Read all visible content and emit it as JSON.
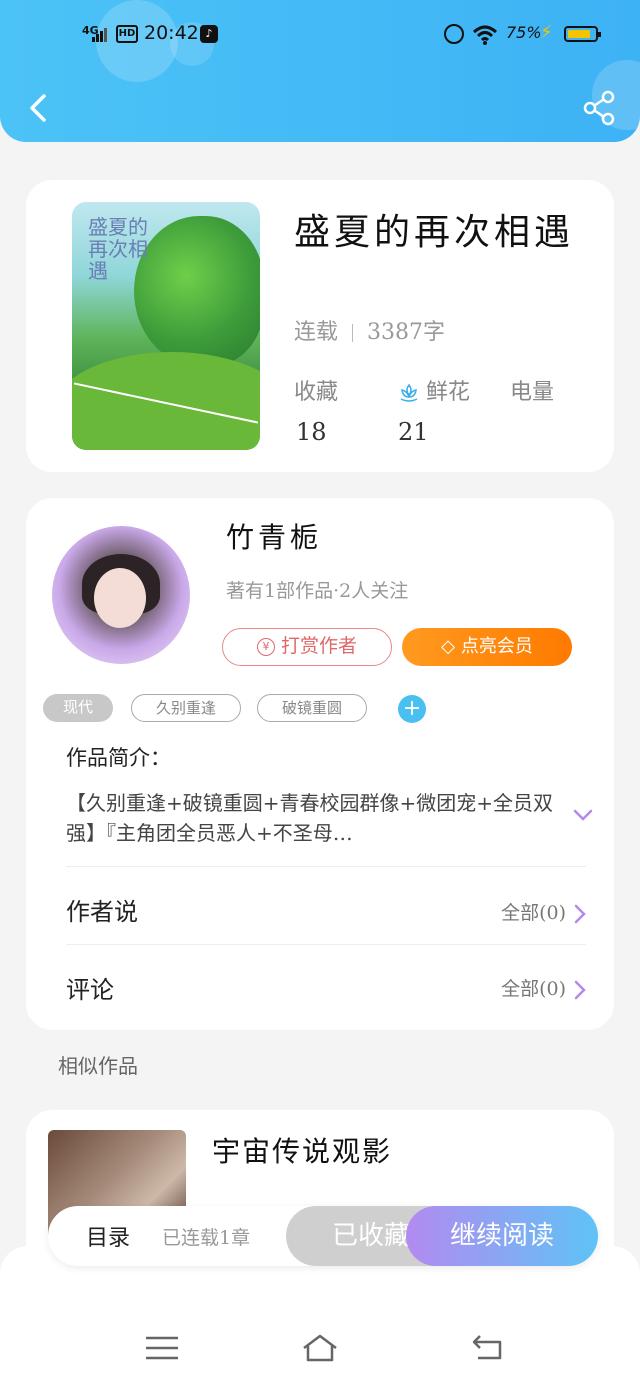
{
  "status_bar": {
    "network": "4G",
    "hd_badge": "HD",
    "time": "20:42",
    "battery_percent": "75%"
  },
  "header": {
    "back_icon": "back-arrow",
    "share_icon": "share"
  },
  "book": {
    "cover_title": "盛夏的再次相遇",
    "title": "盛夏的再次相遇",
    "status": "连载",
    "word_count": "3387字",
    "stats": {
      "favorites_label": "收藏",
      "favorites_value": "18",
      "flowers_label": "鲜花",
      "flowers_value": "21",
      "power_label": "电量"
    }
  },
  "author": {
    "name": "竹青栀",
    "meta": "著有1部作品·2人关注",
    "tip_button": "打赏作者",
    "vip_button": "点亮会员",
    "tags": [
      "现代",
      "久别重逢",
      "破镜重圆"
    ]
  },
  "intro": {
    "label": "作品简介：",
    "text": "【久别重逢+破镜重圆+青春校园群像+微团宠+全员双强】『主角团全员恶人+不圣母…"
  },
  "rows": {
    "author_says": {
      "label": "作者说",
      "value": "全部(0)"
    },
    "comments": {
      "label": "评论",
      "value": "全部(0)"
    }
  },
  "similar": {
    "section_title": "相似作品",
    "items": [
      {
        "title": "宇宙传说观影"
      }
    ]
  },
  "bottom_bar": {
    "toc": "目录",
    "status": "已连载1章",
    "collected": "已收藏",
    "continue": "继续阅读"
  },
  "colors": {
    "header_blue": "#4cc3f6",
    "accent_orange": "#ff8a00",
    "tag_add_blue": "#49c0f0",
    "chev_purple": "#b38af0"
  }
}
